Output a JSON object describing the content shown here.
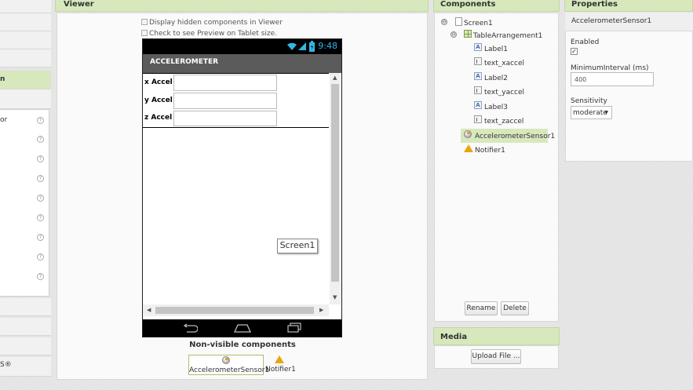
{
  "palette": {
    "section_label_partial": "n",
    "item_label_partial": "or",
    "last_label_partial": "S®",
    "help_glyph": "?"
  },
  "viewer": {
    "title": "Viewer",
    "display_hidden_label": "Display hidden components in Viewer",
    "tablet_preview_label": "Check to see Preview on Tablet size.",
    "status_time": "9:48",
    "app_title": "ACCELEROMETER",
    "rows": [
      {
        "label": "x Accel",
        "value": ""
      },
      {
        "label": "y Accel",
        "value": ""
      },
      {
        "label": "z Accel",
        "value": ""
      }
    ],
    "screen_tooltip": "Screen1",
    "non_visible_label": "Non-visible components",
    "non_visible": [
      {
        "name": "AccelerometerSensor1",
        "icon": "accelerometer-icon"
      },
      {
        "name": "Notifier1",
        "icon": "warning-icon"
      }
    ]
  },
  "components": {
    "title": "Components",
    "tree": {
      "screen": "Screen1",
      "arrangement": "TableArrangement1",
      "children": [
        "Label1",
        "text_xaccel",
        "Label2",
        "text_yaccel",
        "Label3",
        "text_zaccel"
      ],
      "sensor": "AccelerometerSensor1",
      "notifier": "Notifier1"
    },
    "collapse_glyph": "⊖",
    "rename_button": "Rename",
    "delete_button": "Delete"
  },
  "media": {
    "title": "Media",
    "upload_button": "Upload File ..."
  },
  "properties": {
    "title": "Properties",
    "component": "AccelerometerSensor1",
    "enabled_label": "Enabled",
    "enabled": true,
    "min_interval_label": "MinimumInterval (ms)",
    "min_interval_value": "400",
    "sensitivity_label": "Sensitivity",
    "sensitivity_value": "moderate"
  },
  "colors": {
    "header_green": "#d7e8bd",
    "selection_green": "#d7e8bd",
    "android_blue": "#33b5e5",
    "action_bar": "#5b5b5b"
  }
}
